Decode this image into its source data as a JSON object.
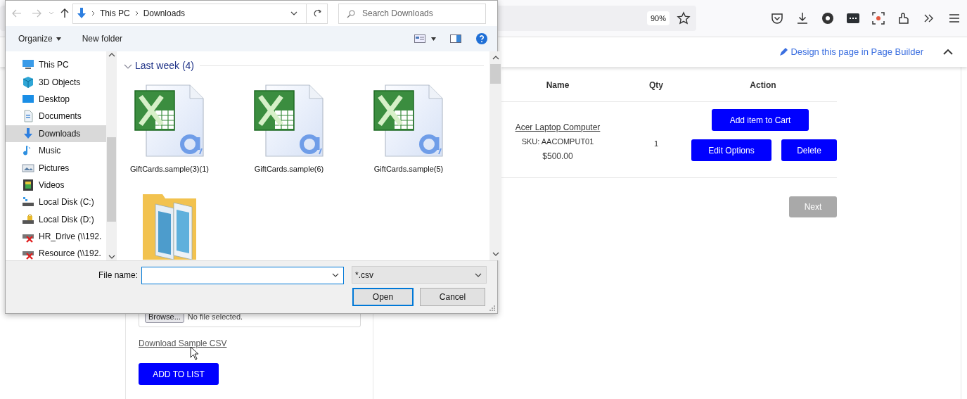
{
  "browser": {
    "zoom": "90%",
    "page_builder_link": "Design this page in Page Builder"
  },
  "upload_panel": {
    "browse_button": "Browse...",
    "file_status": "No file selected.",
    "sample_link": "Download Sample CSV",
    "add_button": "ADD TO LIST"
  },
  "table": {
    "columns": [
      "Name",
      "Qty",
      "Action"
    ],
    "rows": [
      {
        "name": "Acer Laptop Computer",
        "sku": "SKU: AACOMPUT01",
        "price": "$500.00",
        "qty": "1",
        "actions": [
          "Add item to Cart",
          "Edit Options",
          "Delete"
        ]
      }
    ]
  },
  "next_button": {
    "label": "Next",
    "disabled": true
  },
  "dialog": {
    "breadcrumb": [
      "This PC",
      "Downloads"
    ],
    "search": {
      "placeholder": "Search Downloads"
    },
    "toolbar": {
      "organize": "Organize",
      "new_folder": "New folder"
    },
    "nav_items": [
      {
        "label": "This PC",
        "kind": "pc",
        "selected": false
      },
      {
        "label": "3D Objects",
        "kind": "objects",
        "selected": false
      },
      {
        "label": "Desktop",
        "kind": "desktop",
        "selected": false
      },
      {
        "label": "Documents",
        "kind": "documents",
        "selected": false
      },
      {
        "label": "Downloads",
        "kind": "downloads",
        "selected": true
      },
      {
        "label": "Music",
        "kind": "music",
        "selected": false
      },
      {
        "label": "Pictures",
        "kind": "pictures",
        "selected": false
      },
      {
        "label": "Videos",
        "kind": "videos",
        "selected": false
      },
      {
        "label": "Local Disk (C:)",
        "kind": "disk",
        "selected": false
      },
      {
        "label": "Local Disk (D:)",
        "kind": "disk_locked",
        "selected": false
      },
      {
        "label": "HR_Drive (\\\\192.",
        "kind": "network",
        "selected": false
      },
      {
        "label": "Resource (\\\\192.",
        "kind": "network",
        "selected": false
      }
    ],
    "group": {
      "title": "Last week (4)",
      "expanded": true
    },
    "files": [
      {
        "name": "GiftCards.sample(3)(1)",
        "kind": "excel"
      },
      {
        "name": "GiftCards.sample(6)",
        "kind": "excel"
      },
      {
        "name": "GiftCards.sample(5)",
        "kind": "excel"
      },
      {
        "kind": "folder"
      }
    ],
    "file_name": {
      "label": "File name:",
      "focused": true
    },
    "file_type": "*.csv",
    "buttons": {
      "open": "Open",
      "cancel": "Cancel"
    }
  }
}
